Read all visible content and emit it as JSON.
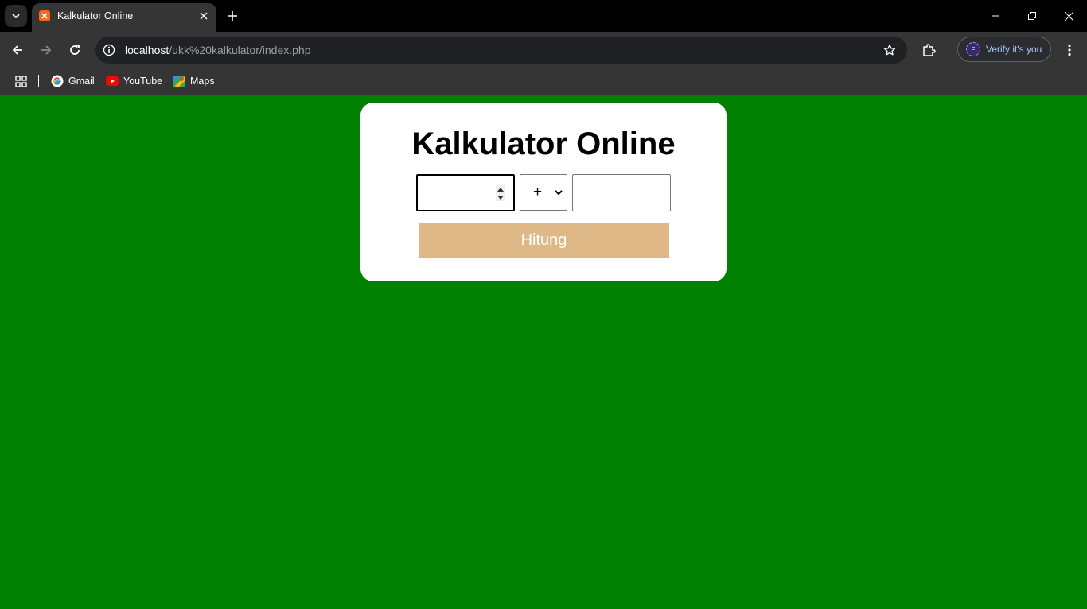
{
  "browser": {
    "tab_title": "Kalkulator Online",
    "url_host": "localhost",
    "url_path": "/ukk%20kalkulator/index.php",
    "profile_initial": "F",
    "profile_label": "Verify it's you",
    "bookmarks": [
      {
        "label": "Gmail",
        "icon": "gmail-icon"
      },
      {
        "label": "YouTube",
        "icon": "youtube-icon"
      },
      {
        "label": "Maps",
        "icon": "maps-icon"
      }
    ]
  },
  "page": {
    "background_color": "#008000",
    "title": "Kalkulator Online",
    "number1_value": "",
    "operator_selected": "+",
    "number2_value": "",
    "submit_label": "Hitung",
    "button_color": "#deb887"
  }
}
